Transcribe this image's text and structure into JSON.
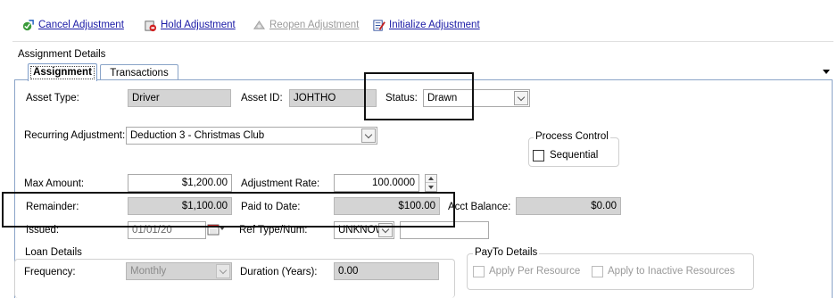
{
  "toolbar": {
    "cancel_label": "Cancel Adjustment",
    "hold_label": "Hold Adjustment",
    "reopen_label": "Reopen Adjustment",
    "initialize_label": "Initialize Adjustment"
  },
  "section": {
    "title": "Assignment Details"
  },
  "tabs": [
    {
      "label": "Assignment"
    },
    {
      "label": "Transactions"
    }
  ],
  "form": {
    "asset_type_label": "Asset Type:",
    "asset_type_value": "Driver",
    "asset_id_label": "Asset ID:",
    "asset_id_value": "JOHTHO",
    "status_label": "Status:",
    "status_value": "Drawn",
    "recurring_label": "Recurring Adjustment:",
    "recurring_value": "Deduction 3 - Christmas Club",
    "process_control_title": "Process Control",
    "sequential_label": "Sequential",
    "max_amount_label": "Max Amount:",
    "max_amount_value": "$1,200.00",
    "adjustment_rate_label": "Adjustment Rate:",
    "adjustment_rate_value": "100.0000",
    "remainder_label": "Remainder:",
    "remainder_value": "$1,100.00",
    "paid_to_date_label": "Paid to Date:",
    "paid_to_date_value": "$100.00",
    "acct_balance_label": "Acct Balance:",
    "acct_balance_value": "$0.00",
    "issued_label": "Issued:",
    "issued_value": "01/01/20",
    "ref_type_label": "Ref Type/Num:",
    "ref_type_value": "UNKNOW",
    "ref_num_value": "",
    "loan_details_title": "Loan Details",
    "frequency_label": "Frequency:",
    "frequency_value": "Monthly",
    "duration_label": "Duration (Years):",
    "duration_value": "0.00",
    "payto_title": "PayTo Details",
    "apply_per_resource_label": "Apply Per Resource",
    "apply_inactive_label": "Apply to Inactive Resources"
  }
}
